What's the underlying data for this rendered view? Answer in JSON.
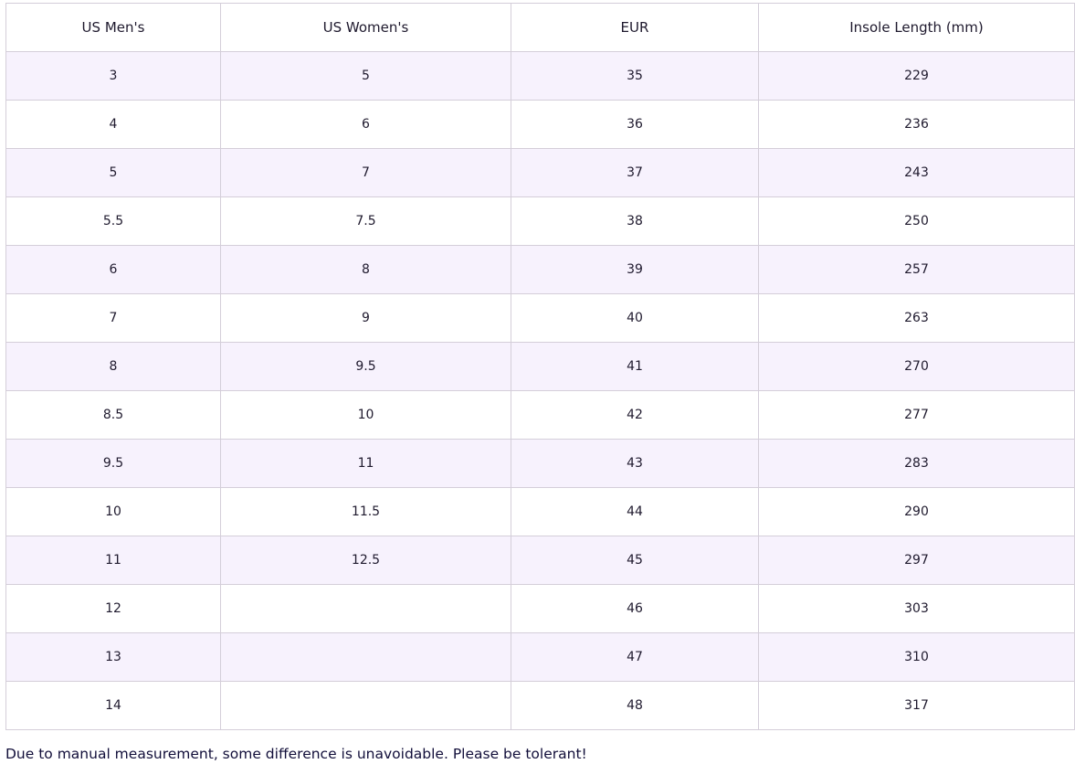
{
  "size_chart": {
    "headers": [
      "US Men's",
      "US Women's",
      "EUR",
      "Insole Length (mm)"
    ],
    "rows": [
      [
        "3",
        "5",
        "35",
        "229"
      ],
      [
        "4",
        "6",
        "36",
        "236"
      ],
      [
        "5",
        "7",
        "37",
        "243"
      ],
      [
        "5.5",
        "7.5",
        "38",
        "250"
      ],
      [
        "6",
        "8",
        "39",
        "257"
      ],
      [
        "7",
        "9",
        "40",
        "263"
      ],
      [
        "8",
        "9.5",
        "41",
        "270"
      ],
      [
        "8.5",
        "10",
        "42",
        "277"
      ],
      [
        "9.5",
        "11",
        "43",
        "283"
      ],
      [
        "10",
        "11.5",
        "44",
        "290"
      ],
      [
        "11",
        "12.5",
        "45",
        "297"
      ],
      [
        "12",
        "",
        "46",
        "303"
      ],
      [
        "13",
        "",
        "47",
        "310"
      ],
      [
        "14",
        "",
        "48",
        "317"
      ]
    ]
  },
  "note": "Due to manual measurement, some difference is unavoidable. Please be tolerant!",
  "colors": {
    "stripe_row": "#f7f2fd",
    "border": "#d4ced9",
    "text": "#1f1a2e",
    "note_text": "#120f3a"
  }
}
